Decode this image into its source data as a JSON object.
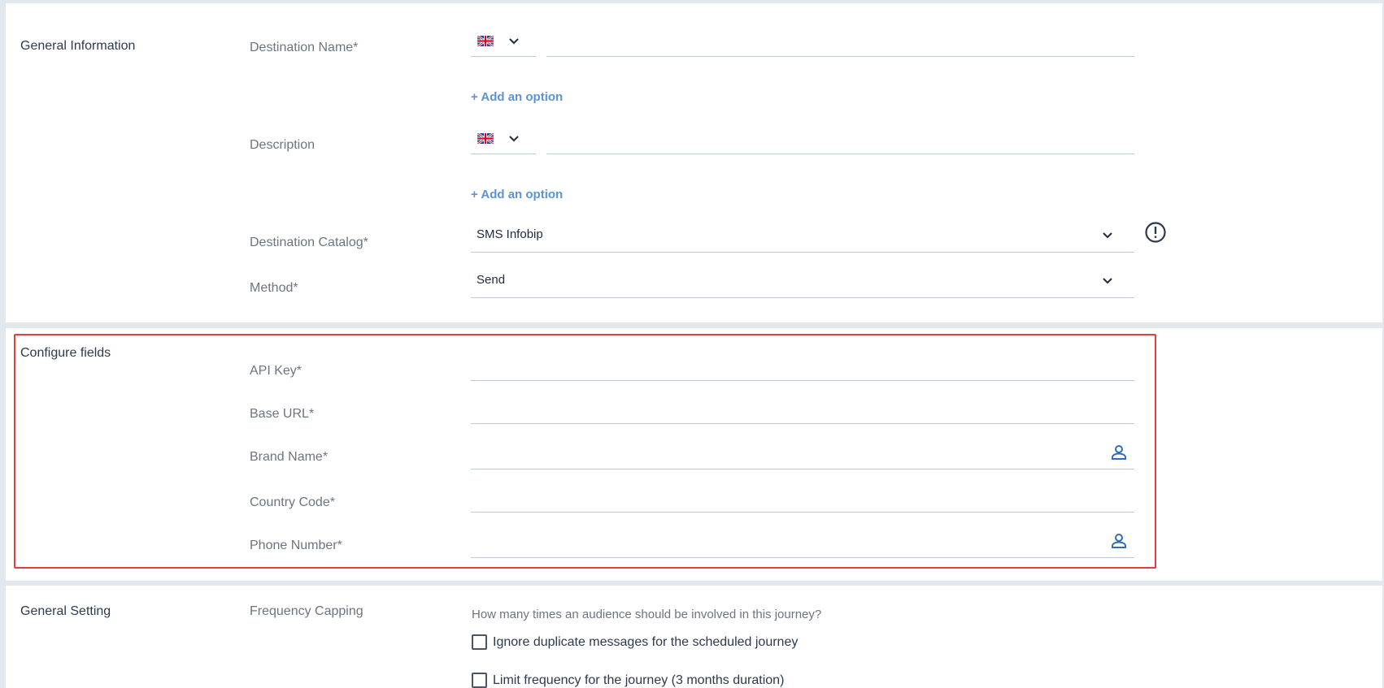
{
  "general_information": {
    "title": "General Information",
    "destination_name_label": "Destination Name*",
    "description_label": "Description",
    "add_option": "+ Add an option",
    "destination_catalog_label": "Destination Catalog*",
    "destination_catalog_value": "SMS Infobip",
    "method_label": "Method*",
    "method_value": "Send"
  },
  "configure_fields": {
    "title": "Configure fields",
    "api_key_label": "API Key*",
    "base_url_label": "Base URL*",
    "brand_name_label": "Brand Name*",
    "country_code_label": "Country Code*",
    "phone_number_label": "Phone Number*"
  },
  "general_setting": {
    "title": "General Setting",
    "frequency_capping_label": "Frequency Capping",
    "hint": "How many times an audience should be involved in this journey?",
    "options": [
      "Ignore duplicate messages for the scheduled journey",
      "Limit frequency for the journey (3 months duration)"
    ]
  },
  "icons": {
    "flag": "uk-flag-icon",
    "dropdown": "chevron-down-icon",
    "info": "exclamation-circle-icon",
    "personalize": "person-icon"
  },
  "colors": {
    "accent_link": "#5b93d3",
    "highlight_border": "#e63d3d",
    "icon_blue": "#2f6db5"
  }
}
